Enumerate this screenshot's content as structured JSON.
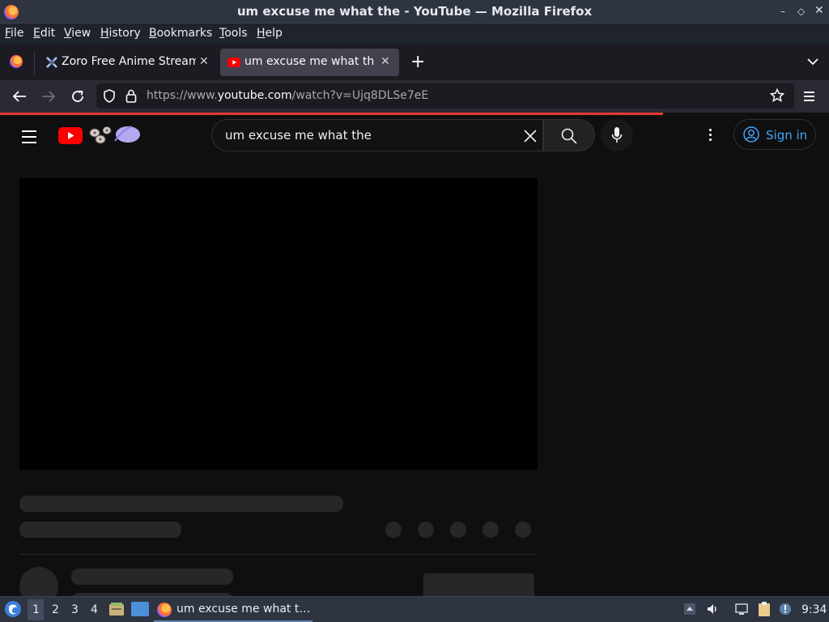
{
  "window": {
    "title": "um excuse me what the - YouTube — Mozilla Firefox"
  },
  "menu": [
    "File",
    "Edit",
    "View",
    "History",
    "Bookmarks",
    "Tools",
    "Help"
  ],
  "tabs": [
    {
      "label": "Zoro Free Anime Streami",
      "active": false
    },
    {
      "label": "um excuse me what the",
      "active": true
    }
  ],
  "address": {
    "prefix": "https://www.",
    "domain": "youtube.com",
    "path": "/watch?v=Ujq8DLSe7eE"
  },
  "youtube": {
    "search_query": "um excuse me what the",
    "signin_label": "Sign in"
  },
  "taskbar": {
    "workspaces": [
      "1",
      "2",
      "3",
      "4"
    ],
    "task_label": "um excuse me what t…",
    "clock": "9:34"
  },
  "colors": {
    "accent": "#3ea6ff",
    "youtube_red": "#ff0000",
    "progress": "#e53935"
  }
}
